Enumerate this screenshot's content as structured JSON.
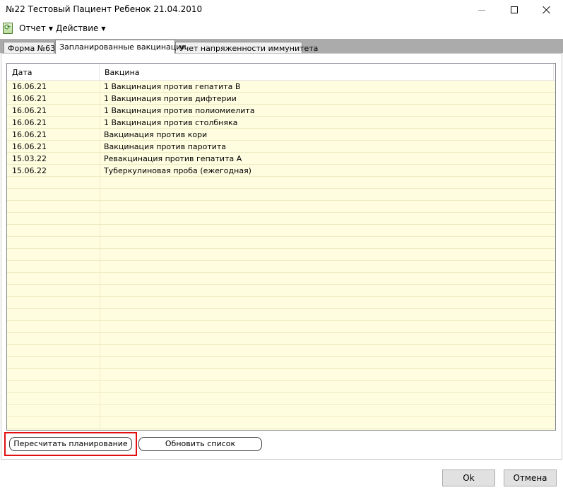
{
  "window": {
    "title": "№22 Тестовый Пациент Ребенок 21.04.2010"
  },
  "menu": {
    "items": [
      {
        "label": "Отчет"
      },
      {
        "label": "Действие"
      }
    ]
  },
  "tabs": [
    {
      "label": "Форма №63",
      "active": false
    },
    {
      "label": "Запланированные вакцинации",
      "active": true
    },
    {
      "label": "Учет напряженности иммунитета",
      "active": false
    }
  ],
  "list": {
    "columns": [
      "Дата",
      "Вакцина"
    ],
    "rows": [
      {
        "date": "16.06.21",
        "vaccine": "1 Вакцинация против гепатита В"
      },
      {
        "date": "16.06.21",
        "vaccine": "1 Вакцинация против дифтерии"
      },
      {
        "date": "16.06.21",
        "vaccine": "1 Вакцинация против полиомиелита"
      },
      {
        "date": "16.06.21",
        "vaccine": "1 Вакцинация против столбняка"
      },
      {
        "date": "16.06.21",
        "vaccine": "Вакцинация против кори"
      },
      {
        "date": "16.06.21",
        "vaccine": "Вакцинация против паротита"
      },
      {
        "date": "15.03.22",
        "vaccine": "Ревакцинация против гепатита А"
      },
      {
        "date": "15.06.22",
        "vaccine": "Туберкулиновая проба (ежегодная)"
      }
    ]
  },
  "actions": {
    "recalculate_label": "Пересчитать планирование",
    "refresh_label": "Обновить список"
  },
  "footer": {
    "ok_label": "Ok",
    "cancel_label": "Отмена"
  },
  "colors": {
    "list_background": "#fffde0",
    "highlight_border": "#e01010",
    "tabstrip_background": "#ababab"
  }
}
